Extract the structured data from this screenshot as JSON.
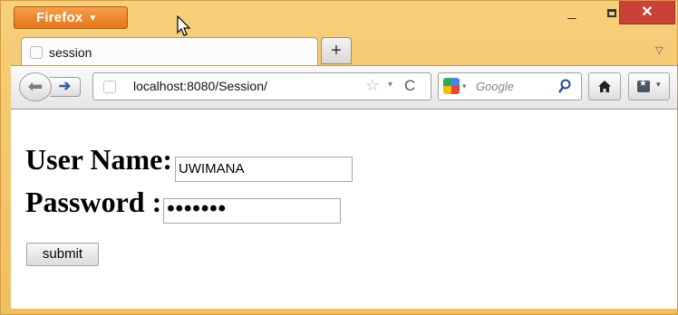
{
  "browser": {
    "menu_button_label": "Firefox",
    "window_controls": {
      "minimize": "_",
      "close": "✕"
    }
  },
  "tabs": [
    {
      "title": "session"
    }
  ],
  "nav": {
    "url": "localhost:8080/Session/",
    "search_placeholder": "Google"
  },
  "form": {
    "username_label": "User Name:",
    "username_value": "UWIMANA",
    "password_label": "Password :",
    "password_masked": "•••••••",
    "submit_label": "submit"
  },
  "colors": {
    "window_frame": "#f3c46a",
    "firefox_button": "#e4761b",
    "close_button": "#c84236"
  }
}
